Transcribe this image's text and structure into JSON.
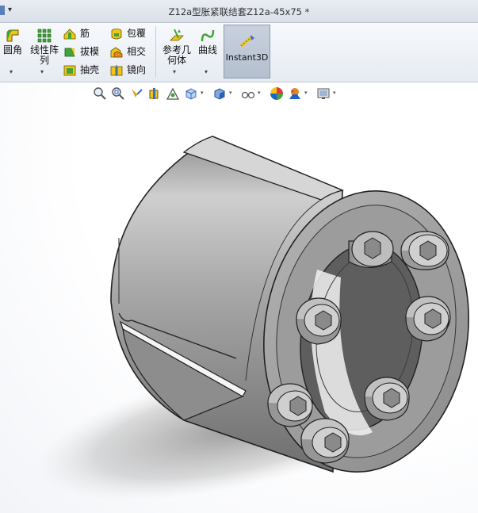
{
  "window": {
    "title": "Z12a型胀紧联结套Z12a-45x75 *",
    "menu_arrow": "▾"
  },
  "ribbon": {
    "fillet": {
      "label": "圆角",
      "icon": "fillet-icon"
    },
    "linear_pattern": {
      "label_line1": "线性阵",
      "label_line2": "列",
      "icon": "linear-pattern-icon"
    },
    "rib": {
      "label": "筋",
      "icon": "rib-icon"
    },
    "draft": {
      "label": "拔模",
      "icon": "draft-icon"
    },
    "shell": {
      "label": "抽壳",
      "icon": "shell-icon"
    },
    "wrap": {
      "label": "包覆",
      "icon": "wrap-icon"
    },
    "intersect": {
      "label": "相交",
      "icon": "intersect-icon"
    },
    "mirror": {
      "label": "镜向",
      "icon": "mirror-icon"
    },
    "reference_geometry": {
      "label_line1": "参考几",
      "label_line2": "何体",
      "icon": "reference-geometry-icon"
    },
    "curves": {
      "label": "曲线",
      "icon": "curves-icon"
    },
    "instant3d": {
      "label": "Instant3D",
      "icon": "instant3d-icon"
    },
    "dropdown_glyph": "▾"
  },
  "view_toolbar": {
    "dropdown_glyph": "▾",
    "icons": [
      "zoom-to-fit-icon",
      "zoom-area-icon",
      "previous-view-icon",
      "section-view-icon",
      "dynamic-annotation-icon",
      "view-orientation-icon",
      "display-style-icon",
      "hide-show-items-icon",
      "edit-appearance-icon",
      "apply-scene-icon",
      "view-settings-icon"
    ]
  },
  "colors": {
    "ribbon_bg": "#e6ebf2",
    "accent_green": "#3fa535",
    "accent_yellow": "#f0c419",
    "model_gray": "#9a9a9a"
  }
}
